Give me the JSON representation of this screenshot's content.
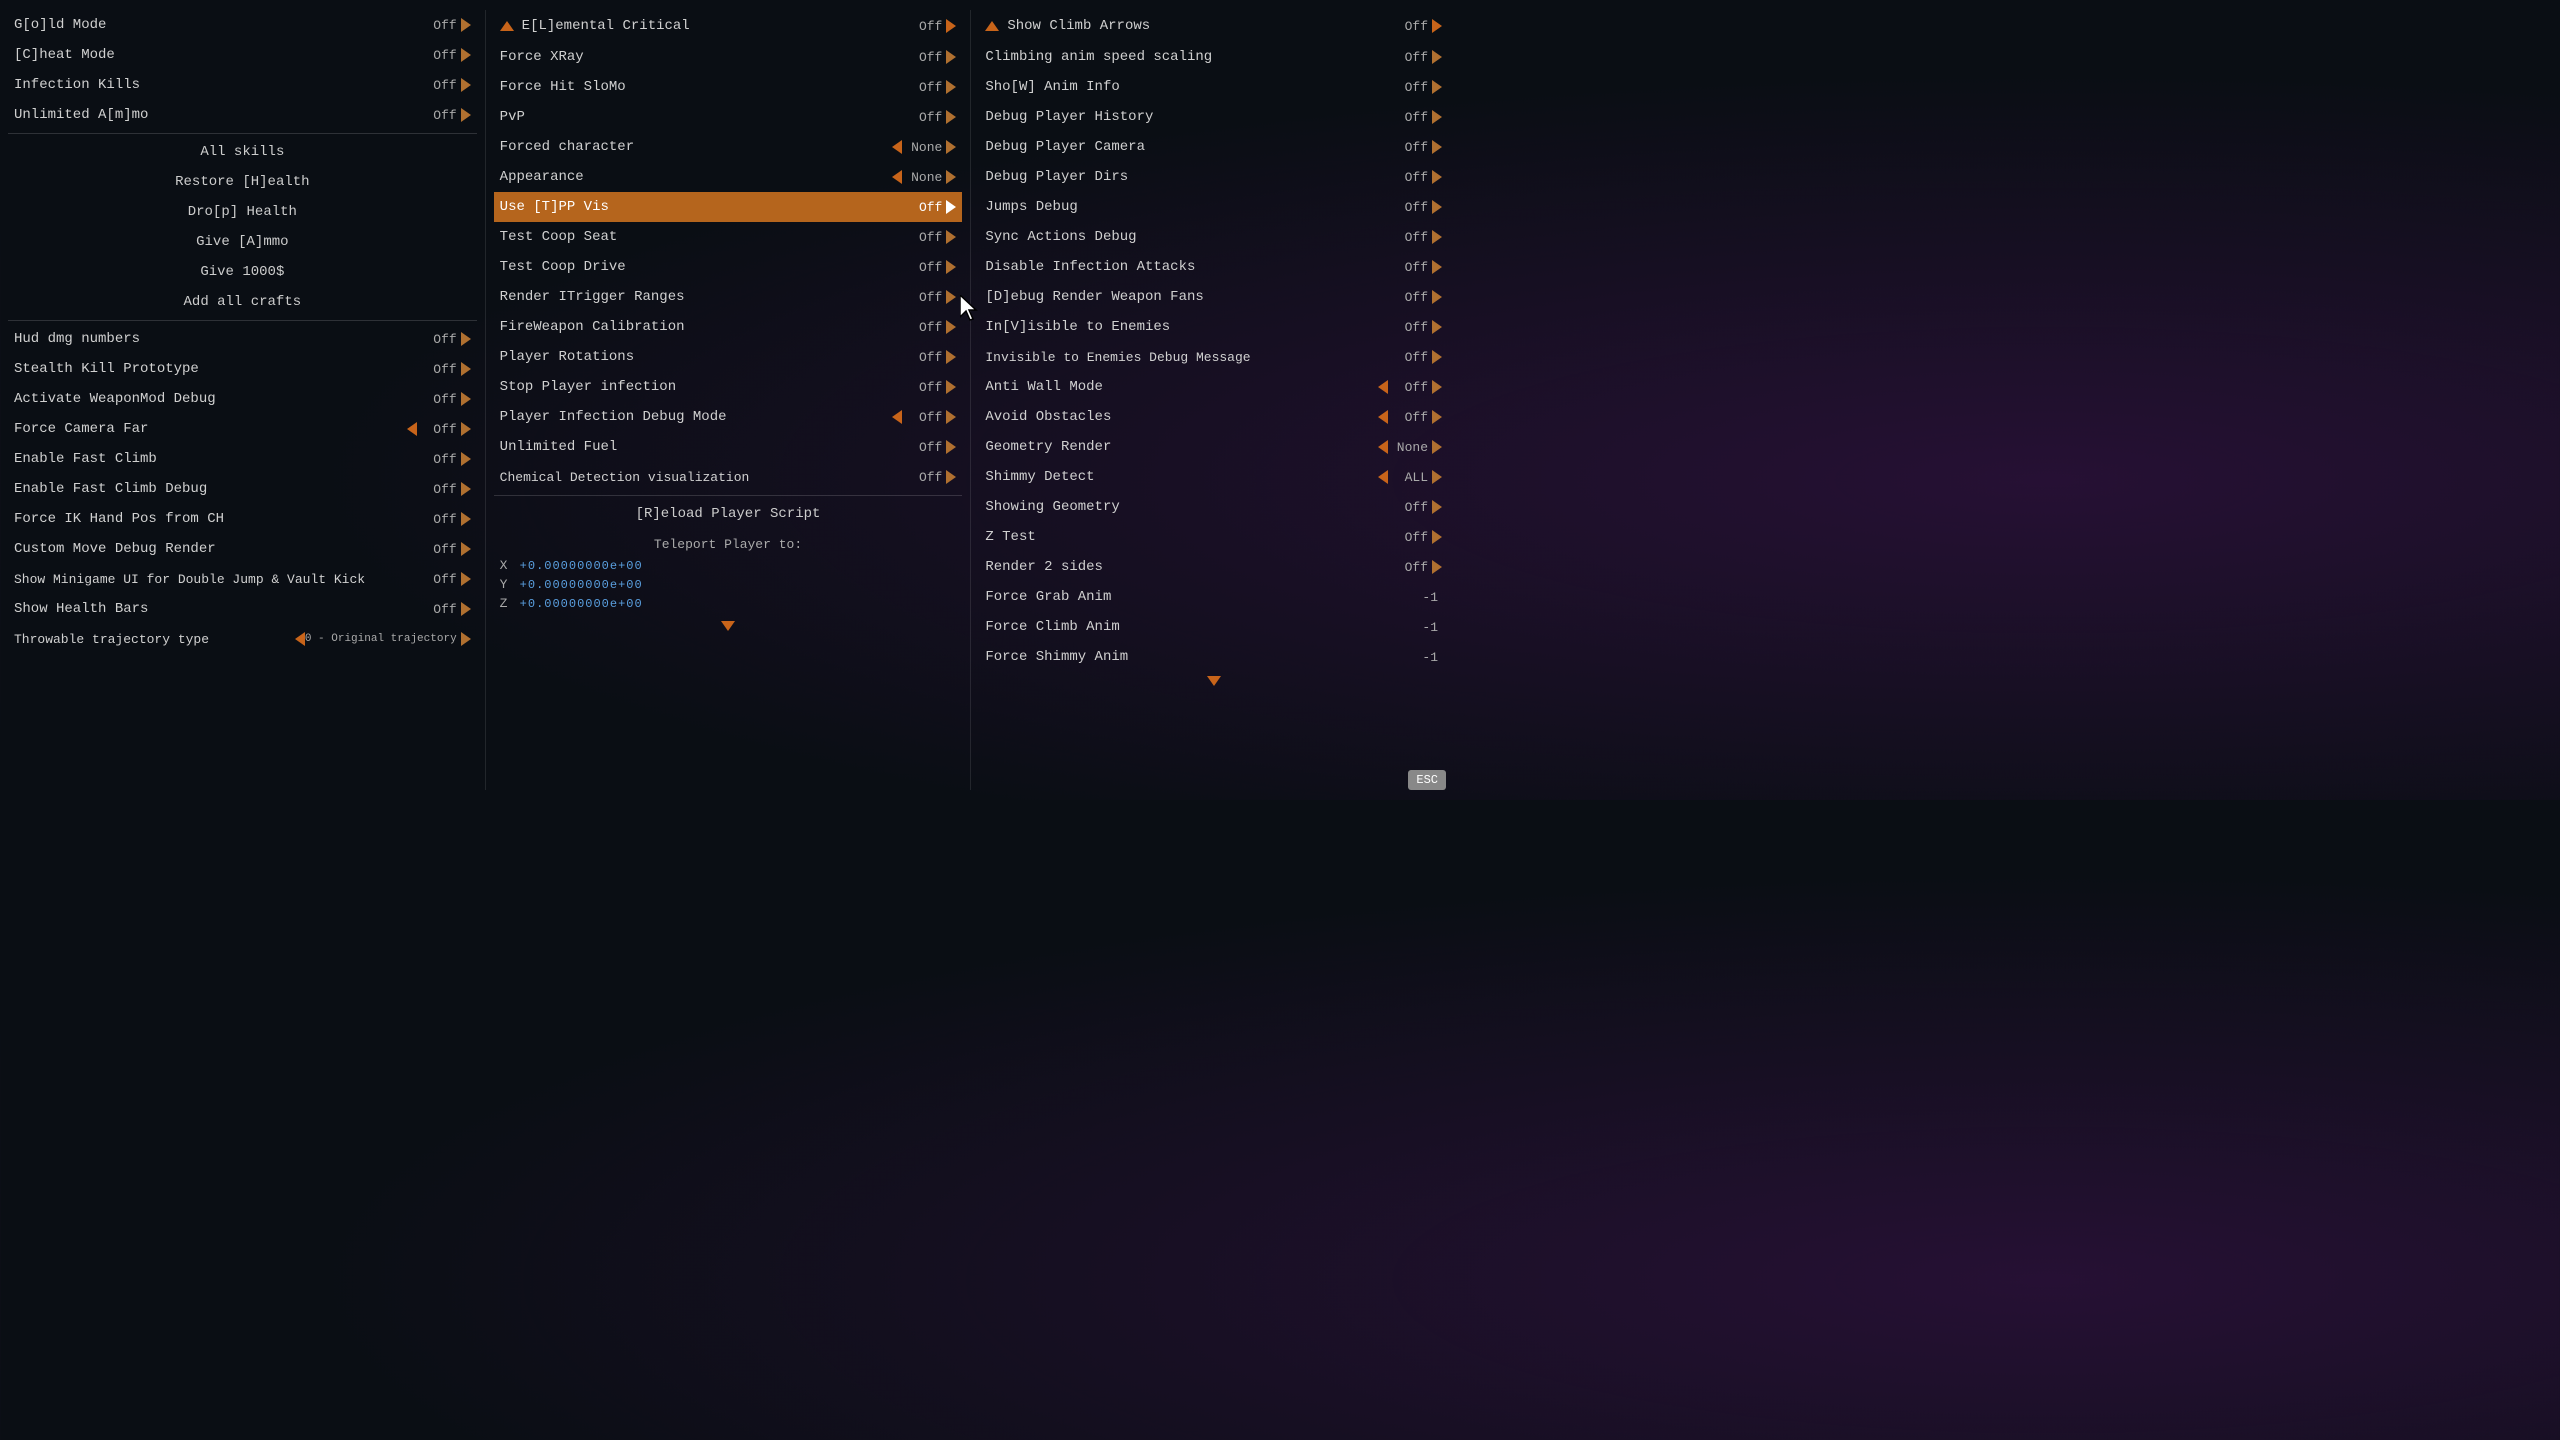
{
  "columns": [
    {
      "id": "col1",
      "items": [
        {
          "id": "gold-mode",
          "label": "G[o]ld Mode",
          "value": "Off",
          "hasLeft": false,
          "hasRight": true,
          "type": "toggle"
        },
        {
          "id": "cheat-mode",
          "label": "[C]heat Mode",
          "value": "Off",
          "hasLeft": false,
          "hasRight": true,
          "type": "toggle"
        },
        {
          "id": "infection-kills",
          "label": "Infection Kills",
          "value": "Off",
          "hasLeft": false,
          "hasRight": true,
          "type": "toggle"
        },
        {
          "id": "unlimited-ammo",
          "label": "Unlimited A[m]mo",
          "value": "Off",
          "hasLeft": false,
          "hasRight": true,
          "type": "toggle"
        },
        {
          "id": "sep1",
          "type": "separator"
        },
        {
          "id": "all-skills",
          "label": "All skills",
          "type": "action"
        },
        {
          "id": "restore-health",
          "label": "Restore [H]ealth",
          "type": "action"
        },
        {
          "id": "drop-health",
          "label": "Dro[p] Health",
          "type": "action"
        },
        {
          "id": "give-ammo",
          "label": "Give [A]mmo",
          "type": "action"
        },
        {
          "id": "give-1000",
          "label": "Give 1000$",
          "type": "action"
        },
        {
          "id": "add-crafts",
          "label": "Add all crafts",
          "type": "action"
        },
        {
          "id": "sep2",
          "type": "separator"
        },
        {
          "id": "hud-dmg",
          "label": "Hud dmg numbers",
          "value": "Off",
          "hasLeft": false,
          "hasRight": true,
          "type": "toggle"
        },
        {
          "id": "stealth-kill",
          "label": "Stealth Kill Prototype",
          "value": "Off",
          "hasLeft": false,
          "hasRight": true,
          "type": "toggle"
        },
        {
          "id": "weaponmod-debug",
          "label": "Activate WeaponMod Debug",
          "value": "Off",
          "hasLeft": false,
          "hasRight": true,
          "type": "toggle"
        },
        {
          "id": "force-camera",
          "label": "Force Camera Far",
          "value": "Off",
          "hasLeft": true,
          "hasRight": true,
          "type": "toggle"
        },
        {
          "id": "enable-fast-climb",
          "label": "Enable Fast Climb",
          "value": "Off",
          "hasLeft": false,
          "hasRight": true,
          "type": "toggle"
        },
        {
          "id": "enable-fast-climb-debug",
          "label": "Enable Fast Climb Debug",
          "value": "Off",
          "hasLeft": false,
          "hasRight": true,
          "type": "toggle"
        },
        {
          "id": "force-ik",
          "label": "Force IK Hand Pos from CH",
          "value": "Off",
          "hasLeft": false,
          "hasRight": true,
          "type": "toggle"
        },
        {
          "id": "custom-move",
          "label": "Custom Move Debug Render",
          "value": "Off",
          "hasLeft": false,
          "hasRight": true,
          "type": "toggle"
        },
        {
          "id": "show-minigame",
          "label": "Show Minigame UI for Double Jump & Vault Kick",
          "value": "Off",
          "hasLeft": false,
          "hasRight": true,
          "type": "toggle"
        },
        {
          "id": "show-health-bars",
          "label": "Show Health Bars",
          "value": "Off",
          "hasLeft": false,
          "hasRight": true,
          "type": "toggle"
        },
        {
          "id": "throwable-traj",
          "label": "Throwable trajectory type",
          "value": "0 - Original trajectory",
          "hasLeft": true,
          "hasRight": true,
          "type": "toggle"
        }
      ]
    },
    {
      "id": "col2",
      "header": {
        "label": "E[L]emental Critical",
        "value": "Off",
        "hasRight": true,
        "hasUp": true
      },
      "items": [
        {
          "id": "force-xray",
          "label": "Force XRay",
          "value": "Off",
          "hasLeft": false,
          "hasRight": true,
          "type": "toggle"
        },
        {
          "id": "force-hit-slomo",
          "label": "Force Hit SloMo",
          "value": "Off",
          "hasLeft": false,
          "hasRight": true,
          "type": "toggle"
        },
        {
          "id": "pvp",
          "label": "PvP",
          "value": "Off",
          "hasLeft": false,
          "hasRight": true,
          "type": "toggle"
        },
        {
          "id": "forced-character",
          "label": "Forced character",
          "value": "None",
          "hasLeft": true,
          "hasRight": true,
          "type": "toggle"
        },
        {
          "id": "appearance",
          "label": "Appearance",
          "value": "None",
          "hasLeft": true,
          "hasRight": true,
          "type": "toggle"
        },
        {
          "id": "use-tpp-vis",
          "label": "Use [T]PP Vis",
          "value": "Off",
          "hasLeft": false,
          "hasRight": true,
          "type": "toggle",
          "highlighted": true
        },
        {
          "id": "test-coop-seat",
          "label": "Test Coop Seat",
          "value": "Off",
          "hasLeft": false,
          "hasRight": true,
          "type": "toggle"
        },
        {
          "id": "test-coop-drive",
          "label": "Test Coop Drive",
          "value": "Off",
          "hasLeft": false,
          "hasRight": true,
          "type": "toggle"
        },
        {
          "id": "render-itrigger",
          "label": "Render ITrigger Ranges",
          "value": "Off",
          "hasLeft": false,
          "hasRight": true,
          "type": "toggle"
        },
        {
          "id": "fireweapon-cal",
          "label": "FireWeapon Calibration",
          "value": "Off",
          "hasLeft": false,
          "hasRight": true,
          "type": "toggle"
        },
        {
          "id": "player-rotations",
          "label": "Player Rotations",
          "value": "Off",
          "hasLeft": false,
          "hasRight": true,
          "type": "toggle"
        },
        {
          "id": "stop-infection",
          "label": "Stop Player infection",
          "value": "Off",
          "hasLeft": false,
          "hasRight": true,
          "type": "toggle"
        },
        {
          "id": "player-infection-debug",
          "label": "Player Infection Debug Mode",
          "value": "Off",
          "hasLeft": true,
          "hasRight": true,
          "type": "toggle"
        },
        {
          "id": "unlimited-fuel",
          "label": "Unlimited Fuel",
          "value": "Off",
          "hasLeft": false,
          "hasRight": true,
          "type": "toggle"
        },
        {
          "id": "chemical-detection",
          "label": "Chemical Detection visualization",
          "value": "Off",
          "hasLeft": false,
          "hasRight": true,
          "type": "toggle"
        },
        {
          "id": "sep-col2",
          "type": "separator"
        },
        {
          "id": "reload-script",
          "label": "[R]eload Player Script",
          "type": "action"
        },
        {
          "id": "teleport-title",
          "label": "Teleport Player to:",
          "type": "teleport-title"
        },
        {
          "id": "teleport-x",
          "label": "X",
          "value": "+0.00000000e+00",
          "type": "teleport"
        },
        {
          "id": "teleport-y",
          "label": "Y",
          "value": "+0.00000000e+00",
          "type": "teleport"
        },
        {
          "id": "teleport-z",
          "label": "Z",
          "value": "+0.00000000e+00",
          "type": "teleport"
        }
      ]
    },
    {
      "id": "col3",
      "header": {
        "label": "Show Climb Arrows",
        "value": "Off",
        "hasRight": true,
        "hasUp": true
      },
      "items": [
        {
          "id": "climbing-anim",
          "label": "Climbing anim speed scaling",
          "value": "Off",
          "hasLeft": false,
          "hasRight": true,
          "type": "toggle"
        },
        {
          "id": "show-anim-info",
          "label": "Sho[W] Anim Info",
          "value": "Off",
          "hasLeft": false,
          "hasRight": true,
          "type": "toggle"
        },
        {
          "id": "debug-player-history",
          "label": "Debug Player History",
          "value": "Off",
          "hasLeft": false,
          "hasRight": true,
          "type": "toggle"
        },
        {
          "id": "debug-player-camera",
          "label": "Debug Player Camera",
          "value": "Off",
          "hasLeft": false,
          "hasRight": true,
          "type": "toggle"
        },
        {
          "id": "debug-player-dirs",
          "label": "Debug Player Dirs",
          "value": "Off",
          "hasLeft": false,
          "hasRight": true,
          "type": "toggle"
        },
        {
          "id": "jumps-debug",
          "label": "Jumps Debug",
          "value": "Off",
          "hasLeft": false,
          "hasRight": true,
          "type": "toggle"
        },
        {
          "id": "sync-actions-debug",
          "label": "Sync Actions Debug",
          "value": "Off",
          "hasLeft": false,
          "hasRight": true,
          "type": "toggle"
        },
        {
          "id": "disable-infection",
          "label": "Disable Infection Attacks",
          "value": "Off",
          "hasLeft": false,
          "hasRight": true,
          "type": "toggle"
        },
        {
          "id": "debug-render-weapon",
          "label": "[D]ebug Render Weapon Fans",
          "value": "Off",
          "hasLeft": false,
          "hasRight": true,
          "type": "toggle"
        },
        {
          "id": "invisible-enemies",
          "label": "In[V]isible to Enemies",
          "value": "Off",
          "hasLeft": false,
          "hasRight": true,
          "type": "toggle"
        },
        {
          "id": "invisible-enemies-debug",
          "label": "Invisible to Enemies Debug Message",
          "value": "Off",
          "hasLeft": false,
          "hasRight": true,
          "type": "toggle"
        },
        {
          "id": "anti-wall",
          "label": "Anti Wall Mode",
          "value": "Off",
          "hasLeft": true,
          "hasRight": true,
          "type": "toggle"
        },
        {
          "id": "avoid-obstacles",
          "label": "Avoid Obstacles",
          "value": "Off",
          "hasLeft": true,
          "hasRight": true,
          "type": "toggle"
        },
        {
          "id": "geometry-render",
          "label": "Geometry Render",
          "value": "None",
          "hasLeft": true,
          "hasRight": true,
          "type": "toggle"
        },
        {
          "id": "shimmy-detect",
          "label": "Shimmy Detect",
          "value": "ALL",
          "hasLeft": true,
          "hasRight": true,
          "type": "toggle"
        },
        {
          "id": "showing-geometry",
          "label": "Showing Geometry",
          "value": "Off",
          "hasLeft": false,
          "hasRight": true,
          "type": "toggle"
        },
        {
          "id": "z-test",
          "label": "Z Test",
          "value": "Off",
          "hasLeft": false,
          "hasRight": true,
          "type": "toggle"
        },
        {
          "id": "render-2sides",
          "label": "Render 2 sides",
          "value": "Off",
          "hasLeft": false,
          "hasRight": true,
          "type": "toggle"
        },
        {
          "id": "force-grab-anim",
          "label": "Force Grab Anim",
          "value": "-1",
          "hasLeft": false,
          "hasRight": false,
          "type": "value"
        },
        {
          "id": "force-climb-anim",
          "label": "Force Climb Anim",
          "value": "-1",
          "hasLeft": false,
          "hasRight": false,
          "type": "value"
        },
        {
          "id": "force-shimmy-anim",
          "label": "Force Shimmy Anim",
          "value": "-1",
          "hasLeft": false,
          "hasRight": false,
          "type": "value"
        }
      ]
    }
  ],
  "esc_label": "ESC",
  "cursor_visible": true
}
